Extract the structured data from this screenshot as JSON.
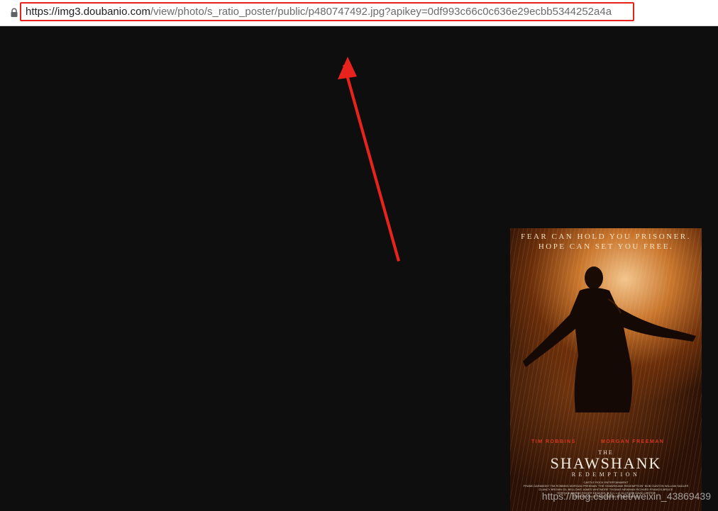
{
  "browser": {
    "url_host": "https://img3.doubanio.com",
    "url_path": "/view/photo/s_ratio_poster/public/p480747492.jpg?apikey=0df993c66c0c636e29ecbb5344252a4a",
    "lock_icon": "lock-icon",
    "highlight_color": "#e8231d"
  },
  "annotation": {
    "arrow_icon": "red-arrow-icon",
    "color": "#e8231d"
  },
  "viewer": {
    "background": "#0e0e0e"
  },
  "poster": {
    "tagline_1": "FEAR CAN HOLD YOU PRISONER.",
    "tagline_2": "HOPE CAN SET YOU FREE.",
    "cast_1": "TIM ROBBINS",
    "cast_2": "MORGAN FREEMAN",
    "title_the": "THE",
    "title_main": "SHAWSHANK",
    "title_sub": "REDEMPTION",
    "billing_1": "CASTLE ROCK ENTERTAINMENT",
    "billing_2": "FRANK DARABONT TIM ROBBINS MORGAN FREEMAN \"THE SHAWSHANK REDEMPTION\" BOB GUNTON WILLIAM SADLER",
    "billing_3": "CLANCY BROWN GIL BELLOWS JAMES WHITMORE THOMAS NEWMAN RICHARD FRANCIS-BRUCE",
    "billing_4": "TERENCE MARSH ROGER DEAKINS, B.S.C. LIZ GLOTZER DAVID LESTER",
    "billing_5": "STEPHEN KING FRANK DARABONT NIKI MARVIN"
  },
  "watermark": {
    "text": "https://blog.csdn.net/weixin_43869439"
  }
}
